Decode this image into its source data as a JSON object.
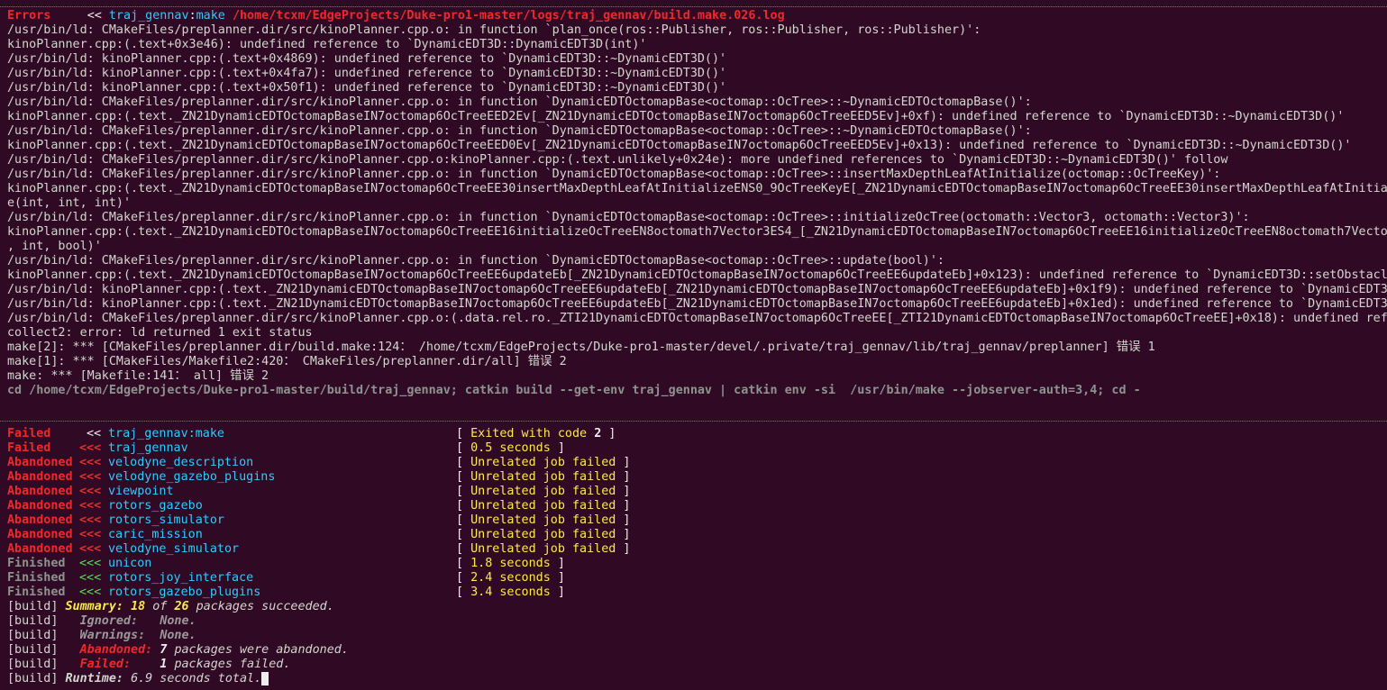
{
  "error_header": {
    "label": "Errors",
    "arrows": "<<",
    "package": "traj_gennav",
    "sep": ":",
    "stage": "make",
    "log_path": "/home/tcxm/EdgeProjects/Duke-pro1-master/logs/traj_gennav/build.make.026.log"
  },
  "log_lines": [
    "/usr/bin/ld: CMakeFiles/preplanner.dir/src/kinoPlanner.cpp.o: in function `plan_once(ros::Publisher, ros::Publisher, ros::Publisher)':",
    "kinoPlanner.cpp:(.text+0x3e46): undefined reference to `DynamicEDT3D::DynamicEDT3D(int)'",
    "/usr/bin/ld: kinoPlanner.cpp:(.text+0x4869): undefined reference to `DynamicEDT3D::~DynamicEDT3D()'",
    "/usr/bin/ld: kinoPlanner.cpp:(.text+0x4fa7): undefined reference to `DynamicEDT3D::~DynamicEDT3D()'",
    "/usr/bin/ld: kinoPlanner.cpp:(.text+0x50f1): undefined reference to `DynamicEDT3D::~DynamicEDT3D()'",
    "/usr/bin/ld: CMakeFiles/preplanner.dir/src/kinoPlanner.cpp.o: in function `DynamicEDTOctomapBase<octomap::OcTree>::~DynamicEDTOctomapBase()':",
    "kinoPlanner.cpp:(.text._ZN21DynamicEDTOctomapBaseIN7octomap6OcTreeEED2Ev[_ZN21DynamicEDTOctomapBaseIN7octomap6OcTreeEED5Ev]+0xf): undefined reference to `DynamicEDT3D::~DynamicEDT3D()'",
    "/usr/bin/ld: CMakeFiles/preplanner.dir/src/kinoPlanner.cpp.o: in function `DynamicEDTOctomapBase<octomap::OcTree>::~DynamicEDTOctomapBase()':",
    "kinoPlanner.cpp:(.text._ZN21DynamicEDTOctomapBaseIN7octomap6OcTreeEED0Ev[_ZN21DynamicEDTOctomapBaseIN7octomap6OcTreeEED5Ev]+0x13): undefined reference to `DynamicEDT3D::~DynamicEDT3D()'",
    "/usr/bin/ld: CMakeFiles/preplanner.dir/src/kinoPlanner.cpp.o:kinoPlanner.cpp:(.text.unlikely+0x24e): more undefined references to `DynamicEDT3D::~DynamicEDT3D()' follow",
    "/usr/bin/ld: CMakeFiles/preplanner.dir/src/kinoPlanner.cpp.o: in function `DynamicEDTOctomapBase<octomap::OcTree>::insertMaxDepthLeafAtInitialize(octomap::OcTreeKey)':",
    "kinoPlanner.cpp:(.text._ZN21DynamicEDTOctomapBaseIN7octomap6OcTreeEE30insertMaxDepthLeafAtInitializeENS0_9OcTreeKeyE[_ZN21DynamicEDTOctomapBaseIN7octomap6OcTreeEE30insertMaxDepthLeafAtInitiali",
    "e(int, int, int)'",
    "/usr/bin/ld: CMakeFiles/preplanner.dir/src/kinoPlanner.cpp.o: in function `DynamicEDTOctomapBase<octomap::OcTree>::initializeOcTree(octomath::Vector3, octomath::Vector3)':",
    "kinoPlanner.cpp:(.text._ZN21DynamicEDTOctomapBaseIN7octomap6OcTreeEE16initializeOcTreeEN8octomath7Vector3ES4_[_ZN21DynamicEDTOctomapBaseIN7octomap6OcTreeEE16initializeOcTreeEN8octomath7Vector3",
    ", int, bool)'",
    "/usr/bin/ld: CMakeFiles/preplanner.dir/src/kinoPlanner.cpp.o: in function `DynamicEDTOctomapBase<octomap::OcTree>::update(bool)':",
    "kinoPlanner.cpp:(.text._ZN21DynamicEDTOctomapBaseIN7octomap6OcTreeEE6updateEb[_ZN21DynamicEDTOctomapBaseIN7octomap6OcTreeEE6updateEb]+0x123): undefined reference to `DynamicEDT3D::setObstacle",
    "/usr/bin/ld: kinoPlanner.cpp:(.text._ZN21DynamicEDTOctomapBaseIN7octomap6OcTreeEE6updateEb[_ZN21DynamicEDTOctomapBaseIN7octomap6OcTreeEE6updateEb]+0x1f9): undefined reference to `DynamicEDT3D",
    "/usr/bin/ld: kinoPlanner.cpp:(.text._ZN21DynamicEDTOctomapBaseIN7octomap6OcTreeEE6updateEb[_ZN21DynamicEDTOctomapBaseIN7octomap6OcTreeEE6updateEb]+0x1ed): undefined reference to `DynamicEDT3D",
    "/usr/bin/ld: CMakeFiles/preplanner.dir/src/kinoPlanner.cpp.o:(.data.rel.ro._ZTI21DynamicEDTOctomapBaseIN7octomap6OcTreeEE[_ZTI21DynamicEDTOctomapBaseIN7octomap6OcTreeEE]+0x18): undefined refer",
    "collect2: error: ld returned 1 exit status",
    "make[2]: *** [CMakeFiles/preplanner.dir/build.make:124： /home/tcxm/EdgeProjects/Duke-pro1-master/devel/.private/traj_gennav/lib/traj_gennav/preplanner] 错误 1",
    "make[1]: *** [CMakeFiles/Makefile2:420： CMakeFiles/preplanner.dir/all] 错误 2",
    "make: *** [Makefile:141： all] 错误 2"
  ],
  "cd_command": "cd /home/tcxm/EdgeProjects/Duke-pro1-master/build/traj_gennav; catkin build --get-env traj_gennav | catkin env -si  /usr/bin/make --jobserver-auth=3,4; cd -",
  "jobs": [
    {
      "status": "Failed",
      "arrows": "<<",
      "package": "traj_gennav",
      "stage": ":make",
      "result": "Exited with code ",
      "code": "2"
    },
    {
      "status": "Failed",
      "arrows": "<<<",
      "package": "traj_gennav",
      "stage": "",
      "result": "0.5 seconds",
      "code": ""
    },
    {
      "status": "Abandoned",
      "arrows": "<<<",
      "package": "velodyne_description",
      "stage": "",
      "result": "Unrelated job failed",
      "code": ""
    },
    {
      "status": "Abandoned",
      "arrows": "<<<",
      "package": "velodyne_gazebo_plugins",
      "stage": "",
      "result": "Unrelated job failed",
      "code": ""
    },
    {
      "status": "Abandoned",
      "arrows": "<<<",
      "package": "viewpoint",
      "stage": "",
      "result": "Unrelated job failed",
      "code": ""
    },
    {
      "status": "Abandoned",
      "arrows": "<<<",
      "package": "rotors_gazebo",
      "stage": "",
      "result": "Unrelated job failed",
      "code": ""
    },
    {
      "status": "Abandoned",
      "arrows": "<<<",
      "package": "rotors_simulator",
      "stage": "",
      "result": "Unrelated job failed",
      "code": ""
    },
    {
      "status": "Abandoned",
      "arrows": "<<<",
      "package": "caric_mission",
      "stage": "",
      "result": "Unrelated job failed",
      "code": ""
    },
    {
      "status": "Abandoned",
      "arrows": "<<<",
      "package": "velodyne_simulator",
      "stage": "",
      "result": "Unrelated job failed",
      "code": ""
    },
    {
      "status": "Finished",
      "arrows": "<<<",
      "package": "unicon",
      "stage": "",
      "result": "1.8 seconds",
      "code": ""
    },
    {
      "status": "Finished",
      "arrows": "<<<",
      "package": "rotors_joy_interface",
      "stage": "",
      "result": "2.4 seconds",
      "code": ""
    },
    {
      "status": "Finished",
      "arrows": "<<<",
      "package": "rotors_gazebo_plugins",
      "stage": "",
      "result": "3.4 seconds",
      "code": ""
    }
  ],
  "summary": {
    "prefix": "[build]",
    "summary_label": "Summary:",
    "succeeded": "18",
    "of_text": "of",
    "total": "26",
    "succeeded_text": "packages succeeded.",
    "ignored_label": "Ignored:",
    "ignored_value": "None.",
    "warnings_label": "Warnings:",
    "warnings_value": "None.",
    "abandoned_label": "Abandoned:",
    "abandoned_count": "7",
    "abandoned_text": "packages were abandoned.",
    "failed_label": "Failed:",
    "failed_count": "1",
    "failed_text": "packages failed.",
    "runtime_label": "Runtime:",
    "runtime_text": "6.9 seconds total."
  },
  "colors": {
    "background": "#300a24",
    "error": "#ef2929",
    "package": "#34c8ff",
    "finished_arrows": "#4ee04e",
    "result": "#fce94f"
  }
}
